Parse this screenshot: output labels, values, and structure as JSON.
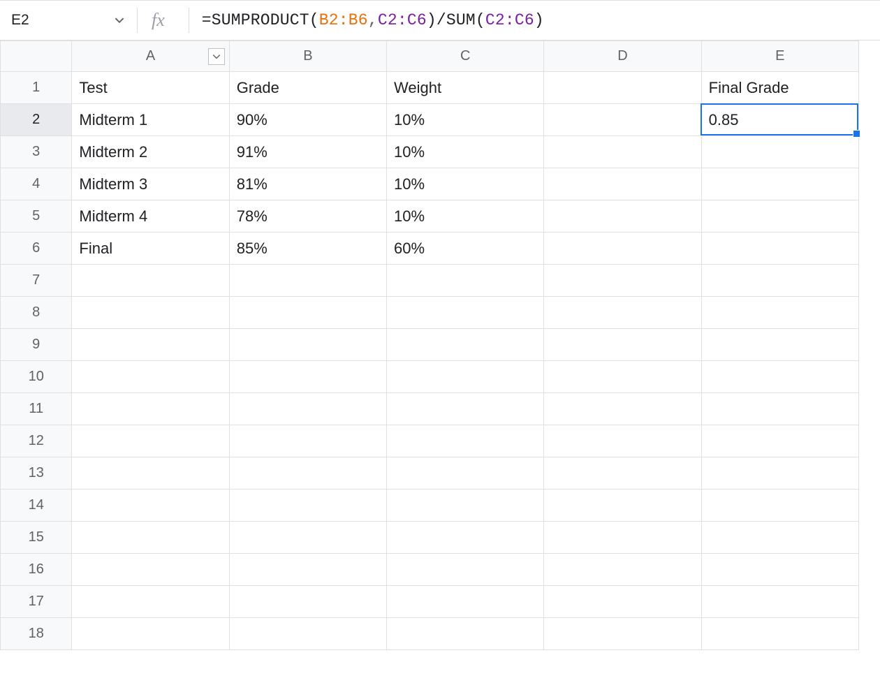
{
  "nameBox": {
    "value": "E2"
  },
  "formulaBar": {
    "prefix": "=SUMPRODUCT(",
    "range1": "B2:B6",
    "sep": ", ",
    "range2": "C2:C6",
    "mid": ")/SUM(",
    "range3": "C2:C6",
    "suffix": ")"
  },
  "columns": [
    "A",
    "B",
    "C",
    "D",
    "E"
  ],
  "rowCount": 18,
  "headers": {
    "A": "Test",
    "B": "Grade",
    "C": "Weight",
    "D": "",
    "E": "Final Grade"
  },
  "data": [
    {
      "A": "Midterm 1",
      "B": "90%",
      "C": "10%",
      "D": "",
      "E": "0.85"
    },
    {
      "A": "Midterm 2",
      "B": "91%",
      "C": "10%",
      "D": "",
      "E": ""
    },
    {
      "A": "Midterm 3",
      "B": "81%",
      "C": "10%",
      "D": "",
      "E": ""
    },
    {
      "A": "Midterm 4",
      "B": "78%",
      "C": "10%",
      "D": "",
      "E": ""
    },
    {
      "A": "Final",
      "B": "85%",
      "C": "60%",
      "D": "",
      "E": ""
    }
  ],
  "selection": {
    "cell": "E2",
    "rowIndex": 2,
    "colIndex": 5
  },
  "colWidths": {
    "row": 100,
    "A": 220,
    "B": 220,
    "C": 220,
    "D": 220,
    "E": 220
  }
}
